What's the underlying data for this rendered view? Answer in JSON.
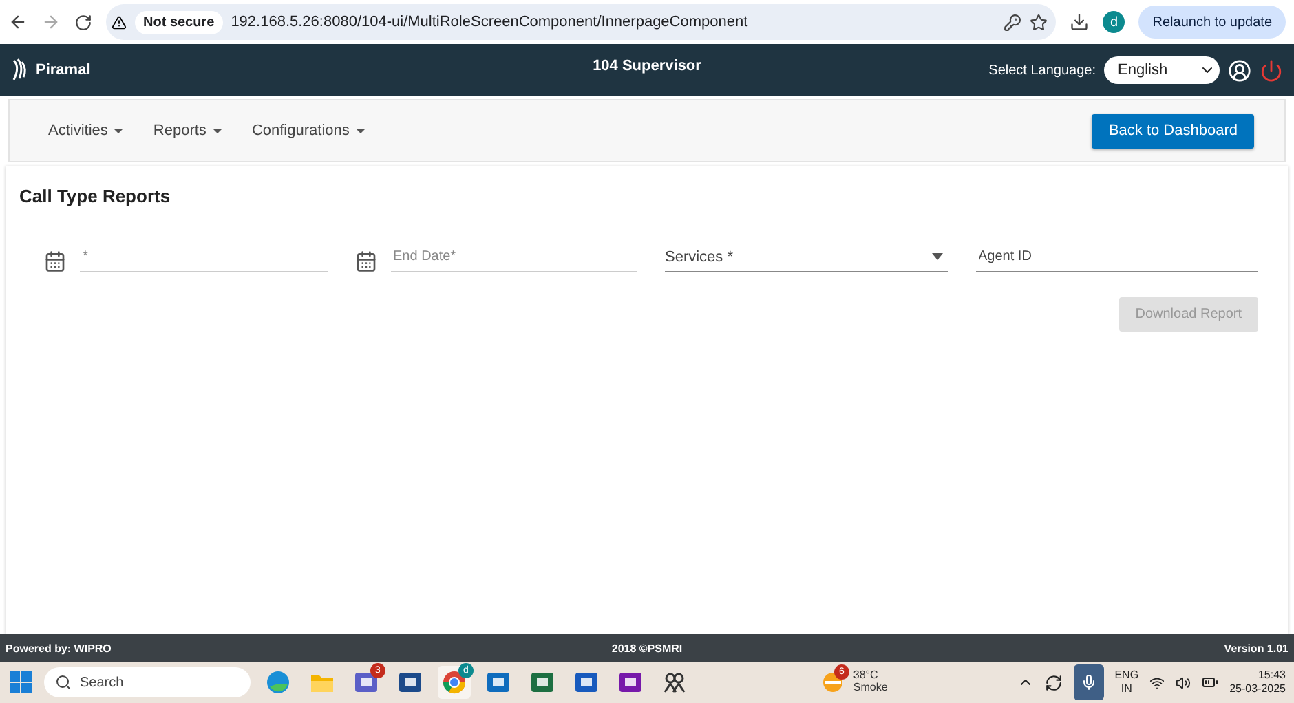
{
  "browser": {
    "security": "Not secure",
    "url": "192.168.5.26:8080/104-ui/MultiRoleScreenComponent/InnerpageComponent",
    "profile": "d",
    "update_button": "Relaunch to update"
  },
  "header": {
    "brand": "Piramal",
    "title": "104 Supervisor",
    "language_label": "Select Language:",
    "language": "English"
  },
  "nav": {
    "menus": [
      "Activities",
      "Reports",
      "Configurations"
    ],
    "back_button": "Back to Dashboard"
  },
  "page": {
    "title": "Call Type Reports",
    "fields": [
      {
        "kind": "date",
        "placeholder": "*"
      },
      {
        "kind": "date",
        "placeholder": "End Date*"
      },
      {
        "kind": "select",
        "label": "Services *"
      },
      {
        "kind": "text",
        "placeholder": "Agent ID"
      }
    ],
    "download_button": {
      "label": "Download Report",
      "disabled": true
    }
  },
  "footer": {
    "left": "Powered by: WIPRO",
    "center": "2018 ©PSMRI",
    "right": "Version 1.01"
  },
  "taskbar": {
    "search_placeholder": "Search",
    "apps": [
      {
        "kind": "edge",
        "selected": false
      },
      {
        "kind": "folder",
        "selected": false
      },
      {
        "kind": "teams",
        "badge": "3",
        "selected": false
      },
      {
        "kind": "store",
        "selected": false
      },
      {
        "kind": "chrome",
        "badge": "d",
        "selected": true
      },
      {
        "kind": "outlook",
        "selected": false
      },
      {
        "kind": "excel",
        "selected": false
      },
      {
        "kind": "word",
        "selected": false
      },
      {
        "kind": "onenote",
        "selected": false
      },
      {
        "kind": "people",
        "selected": false
      }
    ],
    "weather": {
      "badge": "6",
      "temperature": "38°C",
      "condition": "Smoke"
    },
    "language": [
      "ENG",
      "IN"
    ],
    "time": "15:43",
    "date": "25-03-2025"
  }
}
